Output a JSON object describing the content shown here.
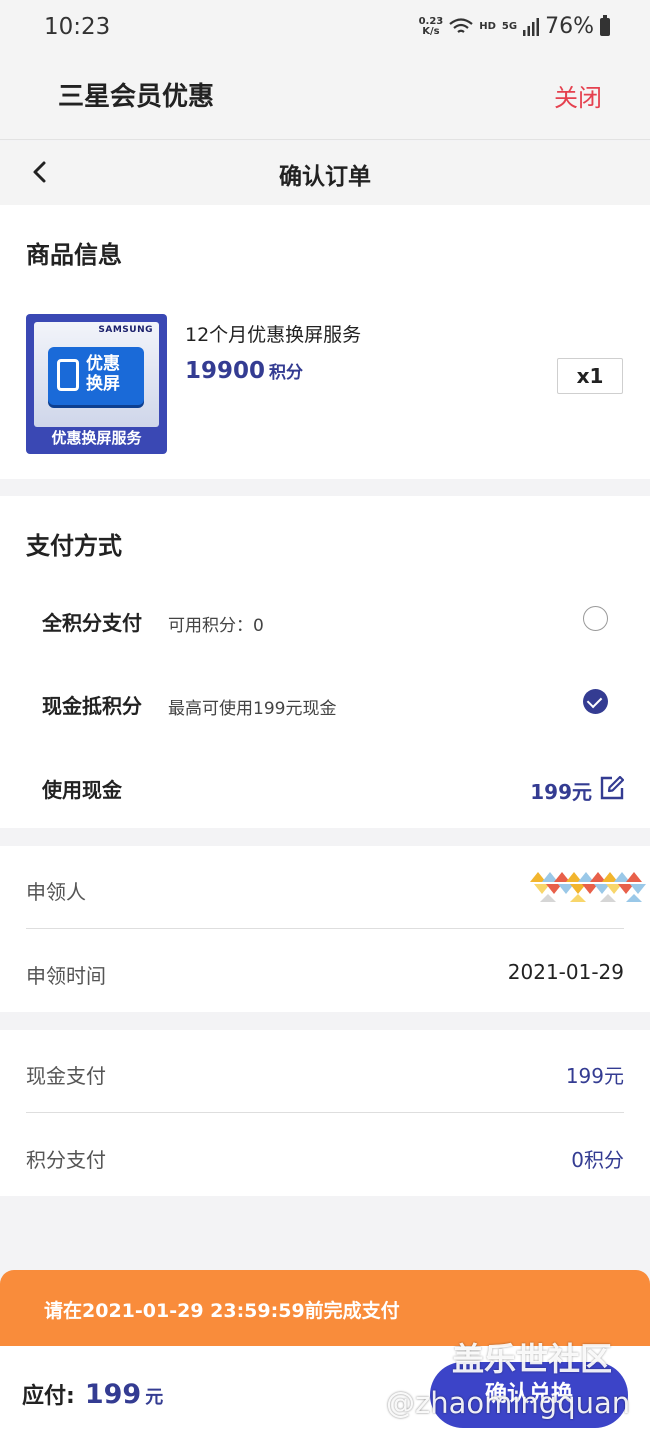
{
  "status_bar": {
    "time": "10:23",
    "net_speed_value": "0.23",
    "net_speed_unit": "K/s",
    "hd": "HD",
    "signal": "5G",
    "battery": "76%"
  },
  "app_bar": {
    "title": "三星会员优惠",
    "close": "关闭"
  },
  "nav": {
    "title": "确认订单"
  },
  "product": {
    "section_title": "商品信息",
    "thumb_brand": "SAMSUNG",
    "thumb_badge": "优惠换屏",
    "thumb_label": "优惠换屏服务",
    "name": "12个月优惠换屏服务",
    "price": "19900",
    "price_unit": "积分",
    "quantity": "x1"
  },
  "payment": {
    "section_title": "支付方式",
    "options": [
      {
        "label": "全积分支付",
        "sub": "可用积分：0",
        "checked": false
      },
      {
        "label": "现金抵积分",
        "sub": "最高可使用199元现金",
        "checked": true
      }
    ],
    "cash_label": "使用现金",
    "cash_value": "199元"
  },
  "applicant": {
    "name_label": "申领人",
    "time_label": "申领时间",
    "time_value": "2021-01-29"
  },
  "summary": {
    "cash_label": "现金支付",
    "cash_value": "199元",
    "points_label": "积分支付",
    "points_value": "0积分"
  },
  "deadline": "请在2021-01-29 23:59:59前完成支付",
  "footer": {
    "due_label": "应付:",
    "due_amount": "199",
    "due_unit": "元",
    "confirm": "确认兑换"
  },
  "watermark": {
    "line1": "盖乐世社区",
    "line2": "@zhaomingquan"
  },
  "colors": {
    "brand": "#343c92",
    "close": "#e5414f",
    "deadline_bg": "#f98c3b",
    "button": "#3c44c8"
  }
}
